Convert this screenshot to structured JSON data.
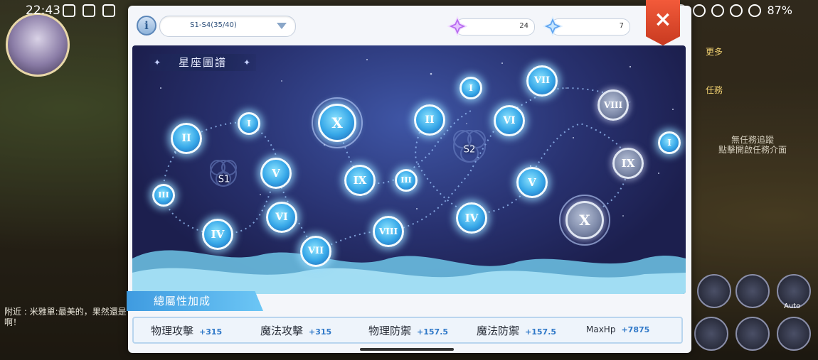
{
  "status_bar": {
    "time": "22:43",
    "battery": "87%"
  },
  "background": {
    "chat_text": "附近 : 米雅單:最美的，果然還是 啊！",
    "side_labels": [
      "更多",
      "任務"
    ],
    "quest_hint": "無任務追蹤\n點擊開啟任務介面",
    "auto_label": "Auto"
  },
  "modal": {
    "info_icon": "i",
    "series_select": {
      "value": "S1-S4(35/40)"
    },
    "currency_1": {
      "icon": "purple-crystal-icon",
      "value": "24"
    },
    "currency_2": {
      "icon": "blue-crystal-icon",
      "value": "7"
    },
    "close_icon": "×"
  },
  "star_map": {
    "title": "星座圖譜",
    "clusters": [
      {
        "label": "S1"
      },
      {
        "label": "S2"
      }
    ],
    "nodes": [
      {
        "id": "s1-1",
        "label": "I",
        "state": "active"
      },
      {
        "id": "s1-2",
        "label": "II",
        "state": "active"
      },
      {
        "id": "s1-3",
        "label": "III",
        "state": "active"
      },
      {
        "id": "s1-4",
        "label": "IV",
        "state": "active"
      },
      {
        "id": "s1-5",
        "label": "V",
        "state": "active"
      },
      {
        "id": "s1-6",
        "label": "VI",
        "state": "active"
      },
      {
        "id": "s1-7",
        "label": "VII",
        "state": "active"
      },
      {
        "id": "s1-8",
        "label": "VIII",
        "state": "active"
      },
      {
        "id": "s1-9",
        "label": "IX",
        "state": "active"
      },
      {
        "id": "s1-10",
        "label": "X",
        "state": "active"
      },
      {
        "id": "s2-1",
        "label": "I",
        "state": "active"
      },
      {
        "id": "s2-2",
        "label": "II",
        "state": "active"
      },
      {
        "id": "s2-3",
        "label": "III",
        "state": "active"
      },
      {
        "id": "s2-4",
        "label": "IV",
        "state": "active"
      },
      {
        "id": "s2-5",
        "label": "V",
        "state": "active"
      },
      {
        "id": "s2-6",
        "label": "VI",
        "state": "active"
      },
      {
        "id": "s2-7",
        "label": "VII",
        "state": "active"
      },
      {
        "id": "s2-8",
        "label": "VIII",
        "state": "locked"
      },
      {
        "id": "s2-9",
        "label": "IX",
        "state": "locked"
      },
      {
        "id": "s2-10",
        "label": "X",
        "state": "locked"
      },
      {
        "id": "s3-1",
        "label": "I",
        "state": "active"
      }
    ]
  },
  "bonus": {
    "tab_label": "總屬性加成",
    "stats": [
      {
        "name": "物理攻擊",
        "value": "+315"
      },
      {
        "name": "魔法攻擊",
        "value": "+315"
      },
      {
        "name": "物理防禦",
        "value": "+157.5"
      },
      {
        "name": "魔法防禦",
        "value": "+157.5"
      },
      {
        "name": "MaxHp",
        "value": "+7875"
      }
    ]
  },
  "colors": {
    "accent_blue": "#36a7e8",
    "close_red": "#e0482a",
    "value_blue": "#2f78c8"
  }
}
